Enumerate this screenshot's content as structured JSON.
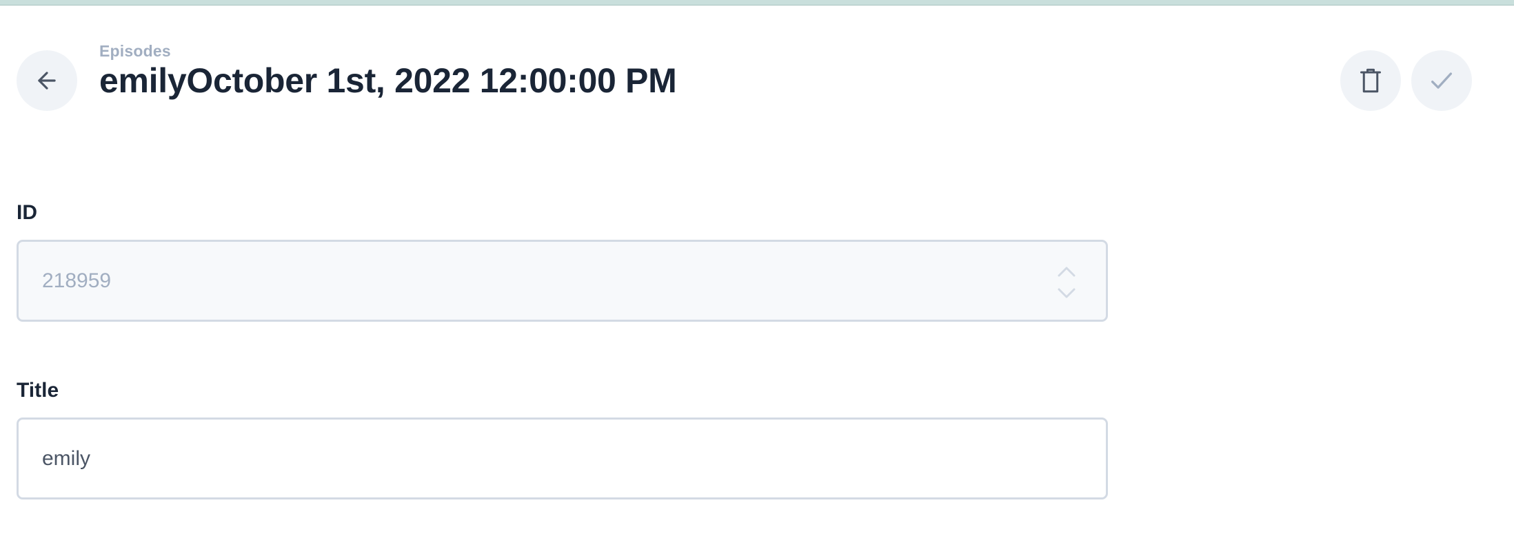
{
  "header": {
    "breadcrumb": "Episodes",
    "title": "emilyOctober 1st, 2022 12:00:00 PM"
  },
  "icons": {
    "back": "arrow-left-icon",
    "delete": "trash-icon",
    "save": "check-icon",
    "stepper": "chevron-up-down-icon"
  },
  "form": {
    "id_label": "ID",
    "id_value": "218959",
    "title_label": "Title",
    "title_value": "emily"
  },
  "colors": {
    "title_text": "#1a2536",
    "muted_text": "#a1aec1",
    "button_bg": "#f0f3f7",
    "border": "#d3dae4",
    "top_strip": "#c9dfdc"
  }
}
